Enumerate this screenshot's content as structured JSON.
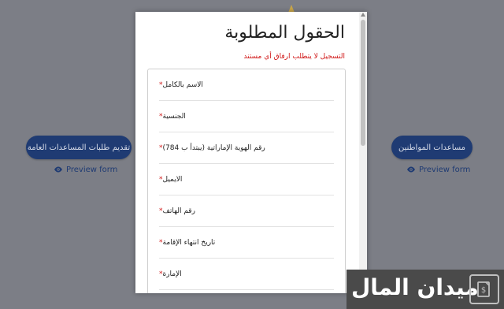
{
  "left_card": {
    "button_label": "تقديم طلبات المساعدات العامة",
    "preview_label": "Preview form"
  },
  "right_card": {
    "button_label": "مساعدات المواطنين",
    "preview_label": "Preview form"
  },
  "modal": {
    "title": "الحقول المطلوبة",
    "note": "التسجيل لا يتطلب ارفاق أي مستند",
    "fields": [
      {
        "label": "الاسم بالكامل",
        "required": "*"
      },
      {
        "label": "الجنسية",
        "required": "*"
      },
      {
        "label": "رقم الهوية الإماراتية (يبتدأ ب 784)",
        "required": "*"
      },
      {
        "label": "الايميل",
        "required": "*"
      },
      {
        "label": "رقم الهاتف",
        "required": "*"
      },
      {
        "label": "تاريخ انتهاء الإقامة",
        "required": "*"
      },
      {
        "label": "الإمارة",
        "required": "*"
      }
    ]
  },
  "watermark": {
    "brand": "ميدان المال",
    "icon": "money-document-icon"
  },
  "colors": {
    "background": "#7c7e86",
    "button": "#1f3b73",
    "required": "#d01414"
  }
}
